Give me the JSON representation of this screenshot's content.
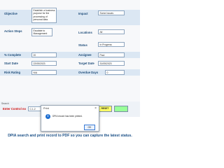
{
  "form": {
    "objective_label": "Objective",
    "objective_value": "Establish a business purpose for the processing of personal data.",
    "impact_label": "Impact",
    "impact_value": "Some Issues",
    "action_steps_label": "Action Steps",
    "action_steps_value": "Escalate to Management",
    "locations_label": "Locations",
    "locations_value": "All",
    "status_label": "Status",
    "status_value": "In Progress",
    "complete_label": "% Complete",
    "complete_value": "20",
    "assignee_label": "Assignee",
    "assignee_value": "Paul",
    "start_date_label": "Start Date",
    "start_date_value": "22/05/2023",
    "target_date_label": "Target Date",
    "target_date_value": "31/05/2023",
    "risk_rating_label": "Risk Rating",
    "risk_rating_value": "N/A",
    "overdue_days_label": "Overdue Days",
    "overdue_days_value": "0"
  },
  "search": {
    "section_label": "Search",
    "control_label": "Enter Control no",
    "control_value": "C.1.2",
    "btn_search": "SEARCH",
    "btn_print": "PRINT",
    "btn_reset": "RESET",
    "btn_4": "",
    "colors": {
      "search": "#ff99ff",
      "print": "#99ccff",
      "reset": "#ffff66",
      "btn_4": "#99ff99"
    }
  },
  "dialog": {
    "title": "Print",
    "message": "DPIA record has been printed.",
    "ok_label": "OK",
    "icon": "info-icon"
  },
  "caption": "DPIA search and print record to PDF so you can capture the latest status.",
  "colors": {
    "accent": "#1a4f86",
    "label": "#1f4d7a",
    "band": "#dbe7f3"
  }
}
